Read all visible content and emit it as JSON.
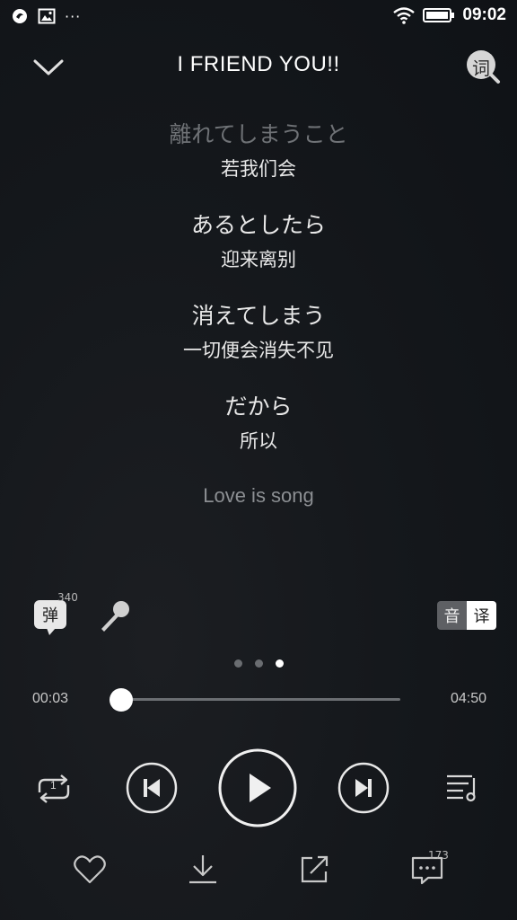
{
  "status_bar": {
    "time": "09:02",
    "left_icons": [
      "app-icon",
      "image-icon",
      "more-dots-icon"
    ],
    "right_icons": [
      "wifi-icon",
      "battery-icon"
    ],
    "more": "···"
  },
  "header": {
    "title": "I FRIEND YOU!!",
    "lyric_search_label": "词"
  },
  "lyrics": [
    {
      "original": "離れてしまうこと",
      "translation": "若我们会",
      "dim": true
    },
    {
      "original": "あるとしたら",
      "translation": "迎来离别"
    },
    {
      "original": "消えてしまう",
      "translation": "一切便会消失不见"
    },
    {
      "original": "だから",
      "translation": "所以"
    }
  ],
  "lyric_next": "Love is song",
  "tools": {
    "danmu_label": "弹",
    "danmu_count": "340",
    "toggle_left": "音",
    "toggle_right": "译",
    "active_toggle": "译"
  },
  "pager": {
    "count": 3,
    "active": 3
  },
  "player": {
    "current_time": "00:03",
    "total_time": "04:50",
    "progress": 0.01,
    "repeat_badge": "1"
  },
  "bottom": {
    "comment_count": "173"
  },
  "colors": {
    "accent": "#31c27c",
    "background": "#15181c"
  }
}
